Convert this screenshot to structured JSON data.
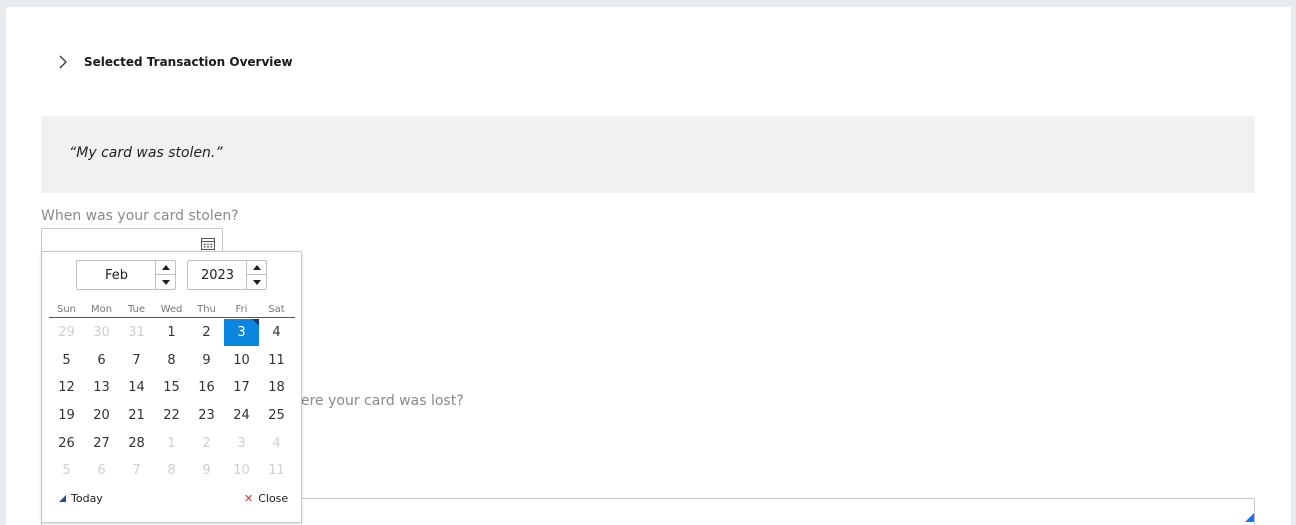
{
  "section": {
    "title": "Selected Transaction Overview",
    "toggle_icon": "chevron-right-icon"
  },
  "quote": {
    "text": "“My card was stolen.”"
  },
  "questions": {
    "when_stolen": "When was your card stolen?",
    "where_lost_visible": "ere your card was lost?"
  },
  "date_field": {
    "value": "",
    "icon": "calendar-icon"
  },
  "date_picker": {
    "month": "Feb",
    "year": "2023",
    "weekdays": [
      "Sun",
      "Mon",
      "Tue",
      "Wed",
      "Thu",
      "Fri",
      "Sat"
    ],
    "weeks": [
      [
        {
          "d": "29",
          "o": true
        },
        {
          "d": "30",
          "o": true
        },
        {
          "d": "31",
          "o": true
        },
        {
          "d": "1"
        },
        {
          "d": "2"
        },
        {
          "d": "3",
          "sel": true
        },
        {
          "d": "4"
        }
      ],
      [
        {
          "d": "5"
        },
        {
          "d": "6"
        },
        {
          "d": "7"
        },
        {
          "d": "8"
        },
        {
          "d": "9"
        },
        {
          "d": "10"
        },
        {
          "d": "11"
        }
      ],
      [
        {
          "d": "12"
        },
        {
          "d": "13"
        },
        {
          "d": "14"
        },
        {
          "d": "15"
        },
        {
          "d": "16"
        },
        {
          "d": "17"
        },
        {
          "d": "18"
        }
      ],
      [
        {
          "d": "19"
        },
        {
          "d": "20"
        },
        {
          "d": "21"
        },
        {
          "d": "22"
        },
        {
          "d": "23"
        },
        {
          "d": "24"
        },
        {
          "d": "25"
        }
      ],
      [
        {
          "d": "26"
        },
        {
          "d": "27"
        },
        {
          "d": "28"
        },
        {
          "d": "1",
          "o": true
        },
        {
          "d": "2",
          "o": true
        },
        {
          "d": "3",
          "o": true
        },
        {
          "d": "4",
          "o": true
        }
      ],
      [
        {
          "d": "5",
          "o": true
        },
        {
          "d": "6",
          "o": true
        },
        {
          "d": "7",
          "o": true
        },
        {
          "d": "8",
          "o": true
        },
        {
          "d": "9",
          "o": true
        },
        {
          "d": "10",
          "o": true
        },
        {
          "d": "11",
          "o": true
        }
      ]
    ],
    "today_label": "Today",
    "close_label": "Close"
  },
  "colors": {
    "accent": "#0b86e0",
    "close_x": "#d9342b"
  }
}
